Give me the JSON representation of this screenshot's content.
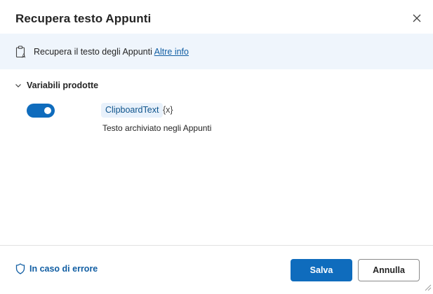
{
  "dialog": {
    "title": "Recupera testo Appunti",
    "close_icon": "close-icon"
  },
  "info": {
    "icon": "clipboard-text-icon",
    "text": "Recupera il testo degli Appunti ",
    "link": "Altre info"
  },
  "variables": {
    "section_label": "Variabili prodotte",
    "expanded": true,
    "items": [
      {
        "enabled": true,
        "name": "ClipboardText",
        "badge": "{x}",
        "description": "Testo archiviato negli Appunti"
      }
    ]
  },
  "footer": {
    "error_label": "In caso di errore",
    "save_label": "Salva",
    "cancel_label": "Annulla"
  },
  "colors": {
    "accent": "#0f6cbd",
    "info_bg": "#eff5fc",
    "link": "#115ea3"
  }
}
